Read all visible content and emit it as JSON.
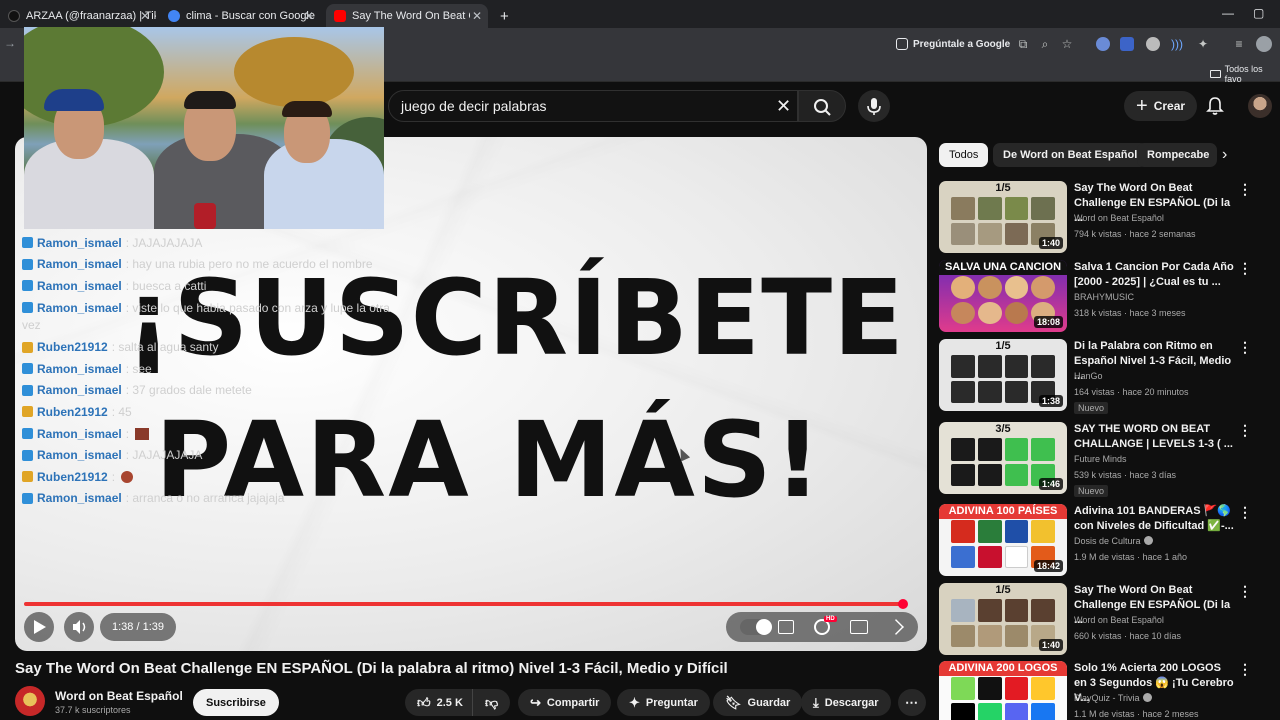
{
  "browser": {
    "tabs": [
      {
        "label": "ARZAA (@fraanarzaa) | TikTok",
        "color": "#111111"
      },
      {
        "label": "clima - Buscar con Google",
        "color": "#4285f4"
      },
      {
        "label": "Say The Word On Beat Challeng",
        "color": "#ff0000"
      }
    ],
    "new_tab": "+",
    "ask_google": "Pregúntale a Google",
    "all_bookmarks": "Todos los favo"
  },
  "header": {
    "search_value": "juego de decir palabras",
    "create_label": "Crear"
  },
  "video": {
    "overlay_line1": "¡SUSCRÍBETE",
    "overlay_line2": "PARA MÁS!",
    "time": "1:38 / 1:39",
    "progress": 0.99,
    "title": "Say The Word On Beat Challenge EN ESPAÑOL (Di la palabra al ritmo) Nivel 1-3 Fácil, Medio y Difícil",
    "channel": "Word on Beat Español",
    "subscribers": "37.7 k suscriptores",
    "subscribe_label": "Suscribirse",
    "actions": {
      "likes": "2.5 K",
      "share": "Compartir",
      "ask": "Preguntar",
      "save": "Guardar",
      "download": "Descargar"
    }
  },
  "chat": [
    {
      "user": "Ramon_ismael",
      "msg": ": JAJAJAJAJA",
      "badge": "blue"
    },
    {
      "user": "Ramon_ismael",
      "msg": ": hay una rubia pero no me acuerdo el nombre",
      "badge": "blue"
    },
    {
      "user": "Ramon_ismael",
      "msg": ": buesca a catti",
      "badge": "blue"
    },
    {
      "user": "Ramon_ismael",
      "msg": ": viste lo que habia pasado con arza y lupe la otra",
      "badge": "blue"
    },
    {
      "user": "Ruben21912",
      "msg": ": salta al agua santy",
      "badge": "gold"
    },
    {
      "user": "Ramon_ismael",
      "msg": ": see",
      "badge": "blue"
    },
    {
      "user": "Ramon_ismael",
      "msg": ": 37 grados dale metete",
      "badge": "blue"
    },
    {
      "user": "Ruben21912",
      "msg": ": 45",
      "badge": "gold"
    },
    {
      "user": "Ramon_ismael",
      "msg": ":",
      "badge": "blue"
    },
    {
      "user": "Ramon_ismael",
      "msg": ": JAJAJAJAJA",
      "badge": "blue"
    },
    {
      "user": "Ruben21912",
      "msg": ":",
      "badge": "gold"
    },
    {
      "user": "Ramon_ismael",
      "msg": ": arranca o no arranca jajajaja",
      "badge": "blue"
    }
  ],
  "chat_continuation": "vez",
  "chips": [
    "Todos",
    "De Word on Beat Español",
    "Rompecabe"
  ],
  "recommendations": [
    {
      "title": "Say The Word On Beat Challenge EN ESPAÑOL (Di la ...",
      "channel": "Word on Beat Español",
      "meta": "794 k vistas · hace 2 semanas",
      "duration": "1:40",
      "thumb_top": "1/5",
      "new": false
    },
    {
      "title": "Salva 1 Cancion Por Cada Año [2000 - 2025] | ¿Cual es tu ...",
      "channel": "BRAHYMUSIC",
      "meta": "318 k vistas · hace 3 meses",
      "duration": "18:08",
      "thumb_top": "SALVA UNA CANCION",
      "new": false
    },
    {
      "title": "Di la Palabra con Ritmo en Español Nivel 1-3 Fácil, Medio ...",
      "channel": "HanGo",
      "meta": "164 vistas · hace 20 minutos",
      "duration": "1:38",
      "thumb_top": "1/5",
      "new": true,
      "new_label": "Nuevo"
    },
    {
      "title": "SAY THE WORD ON BEAT CHALLANGE | LEVELS 1-3 ( ...",
      "channel": "Future Minds",
      "meta": "539 k vistas · hace 3 días",
      "duration": "1:46",
      "thumb_top": "3/5",
      "new": true,
      "new_label": "Nuevo"
    },
    {
      "title": "Adivina 101 BANDERAS 🚩🌎 con Niveles de Dificultad ✅-...",
      "channel": "Dosis de Cultura",
      "meta": "1.9 M de vistas · hace 1 año",
      "duration": "18:42",
      "thumb_top": "ADIVINA 100 PAÍSES",
      "new": false,
      "verified": true
    },
    {
      "title": "Say The Word On Beat Challenge EN ESPAÑOL (Di la ...",
      "channel": "Word on Beat Español",
      "meta": "660 k vistas · hace 10 días",
      "duration": "1:40",
      "thumb_top": "1/5",
      "new": false
    },
    {
      "title": "Solo 1% Acierta 200 LOGOS en 3 Segundos 😱 ¡Tu Cerebro V...",
      "channel": "PlayQuiz - Trivia",
      "meta": "1.1 M de vistas · hace 2 meses",
      "duration": "",
      "thumb_top": "ADIVINA 200 LOGOS",
      "new": false,
      "verified": true
    }
  ],
  "colors": {
    "accent_red": "#ff0033",
    "bg": "#0f0f0f",
    "chip_bg": "#272727"
  }
}
